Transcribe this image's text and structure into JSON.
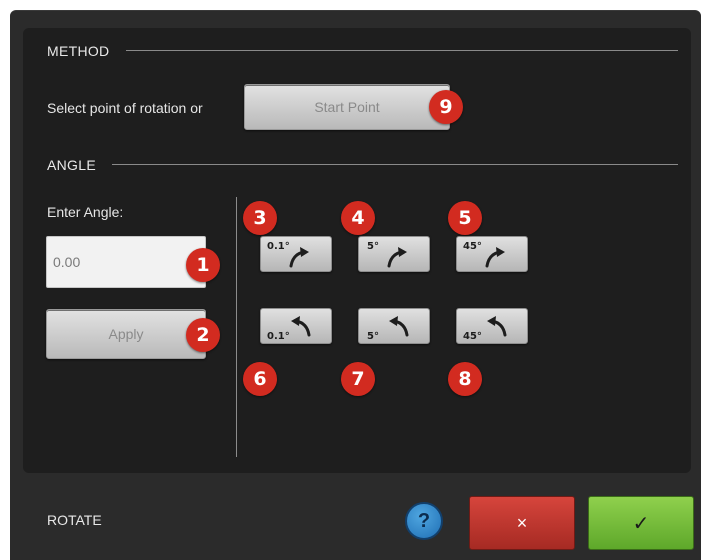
{
  "method": {
    "title": "METHOD",
    "prompt": "Select point of rotation or",
    "start_point_label": "Start Point",
    "badge": "9"
  },
  "angle": {
    "title": "ANGLE",
    "enter_label": "Enter Angle:",
    "input_value": "0.00",
    "apply_label": "Apply",
    "badges": {
      "input": "1",
      "apply": "2"
    },
    "cw_buttons": [
      {
        "value": "0.1°",
        "badge": "3"
      },
      {
        "value": "5°",
        "badge": "4"
      },
      {
        "value": "45°",
        "badge": "5"
      }
    ],
    "ccw_buttons": [
      {
        "value": "0.1°",
        "badge": "6"
      },
      {
        "value": "5°",
        "badge": "7"
      },
      {
        "value": "45°",
        "badge": "8"
      }
    ]
  },
  "footer": {
    "title": "ROTATE",
    "help_label": "?",
    "cancel_label": "×",
    "confirm_label": "✓"
  },
  "colors": {
    "background": "#2b2b2b",
    "panel": "#1e1e1e",
    "badge": "#d22b20",
    "cancel": "#c23a31",
    "confirm": "#7cc13f",
    "help": "#2f88cf"
  }
}
